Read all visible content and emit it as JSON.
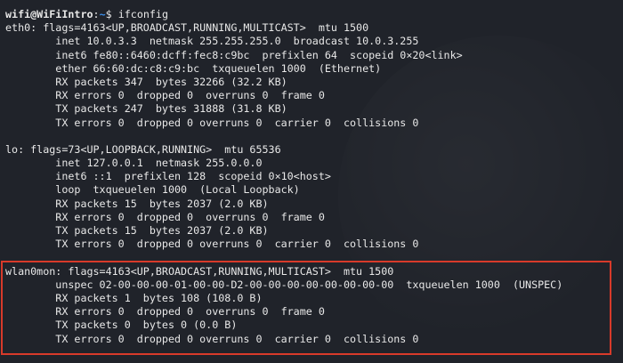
{
  "prompt": {
    "user_host": "wifi@WiFiIntro",
    "path": "~",
    "symbol": "$",
    "command": "ifconfig"
  },
  "eth0": [
    "eth0: flags=4163<UP,BROADCAST,RUNNING,MULTICAST>  mtu 1500",
    "        inet 10.0.3.3  netmask 255.255.255.0  broadcast 10.0.3.255",
    "        inet6 fe80::6460:dcff:fec8:c9bc  prefixlen 64  scopeid 0×20<link>",
    "        ether 66:60:dc:c8:c9:bc  txqueuelen 1000  (Ethernet)",
    "        RX packets 347  bytes 32266 (32.2 KB)",
    "        RX errors 0  dropped 0  overruns 0  frame 0",
    "        TX packets 247  bytes 31888 (31.8 KB)",
    "        TX errors 0  dropped 0 overruns 0  carrier 0  collisions 0"
  ],
  "lo": [
    "lo: flags=73<UP,LOOPBACK,RUNNING>  mtu 65536",
    "        inet 127.0.0.1  netmask 255.0.0.0",
    "        inet6 ::1  prefixlen 128  scopeid 0×10<host>",
    "        loop  txqueuelen 1000  (Local Loopback)",
    "        RX packets 15  bytes 2037 (2.0 KB)",
    "        RX errors 0  dropped 0  overruns 0  frame 0",
    "        TX packets 15  bytes 2037 (2.0 KB)",
    "        TX errors 0  dropped 0 overruns 0  carrier 0  collisions 0"
  ],
  "wlan0mon": [
    "wlan0mon: flags=4163<UP,BROADCAST,RUNNING,MULTICAST>  mtu 1500",
    "        unspec 02-00-00-00-01-00-00-D2-00-00-00-00-00-00-00-00  txqueuelen 1000  (UNSPEC)",
    "        RX packets 1  bytes 108 (108.0 B)",
    "        RX errors 0  dropped 0  overruns 0  frame 0",
    "        TX packets 0  bytes 0 (0.0 B)",
    "        TX errors 0  dropped 0 overruns 0  carrier 0  collisions 0"
  ],
  "colors": {
    "background": "#20232a",
    "text": "#e8e8e8",
    "path": "#3b8eea",
    "highlight_border": "#d83a2a"
  }
}
